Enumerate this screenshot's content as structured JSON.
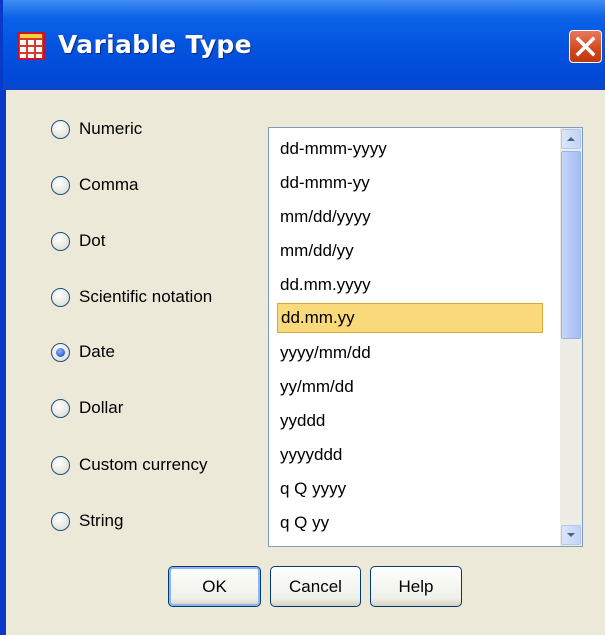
{
  "window": {
    "title": "Variable Type",
    "icon": "grid-app-icon",
    "close_icon": "close-icon"
  },
  "types": [
    {
      "label": "Numeric",
      "selected": false
    },
    {
      "label": "Comma",
      "selected": false
    },
    {
      "label": "Dot",
      "selected": false
    },
    {
      "label": "Scientific notation",
      "selected": false
    },
    {
      "label": "Date",
      "selected": true
    },
    {
      "label": "Dollar",
      "selected": false
    },
    {
      "label": "Custom currency",
      "selected": false
    },
    {
      "label": "String",
      "selected": false
    }
  ],
  "formats": {
    "items": [
      "dd-mmm-yyyy",
      "dd-mmm-yy",
      "mm/dd/yyyy",
      "mm/dd/yy",
      "dd.mm.yyyy",
      "dd.mm.yy",
      "yyyy/mm/dd",
      "yy/mm/dd",
      "yyddd",
      "yyyyddd",
      "q Q yyyy",
      "q Q yy"
    ],
    "selected": "dd.mm.yy"
  },
  "buttons": {
    "ok": "OK",
    "cancel": "Cancel",
    "help": "Help"
  },
  "colors": {
    "titlebar": "#0a5ae2",
    "selection": "#f9d97a",
    "dialog_bg": "#ece9d8"
  }
}
